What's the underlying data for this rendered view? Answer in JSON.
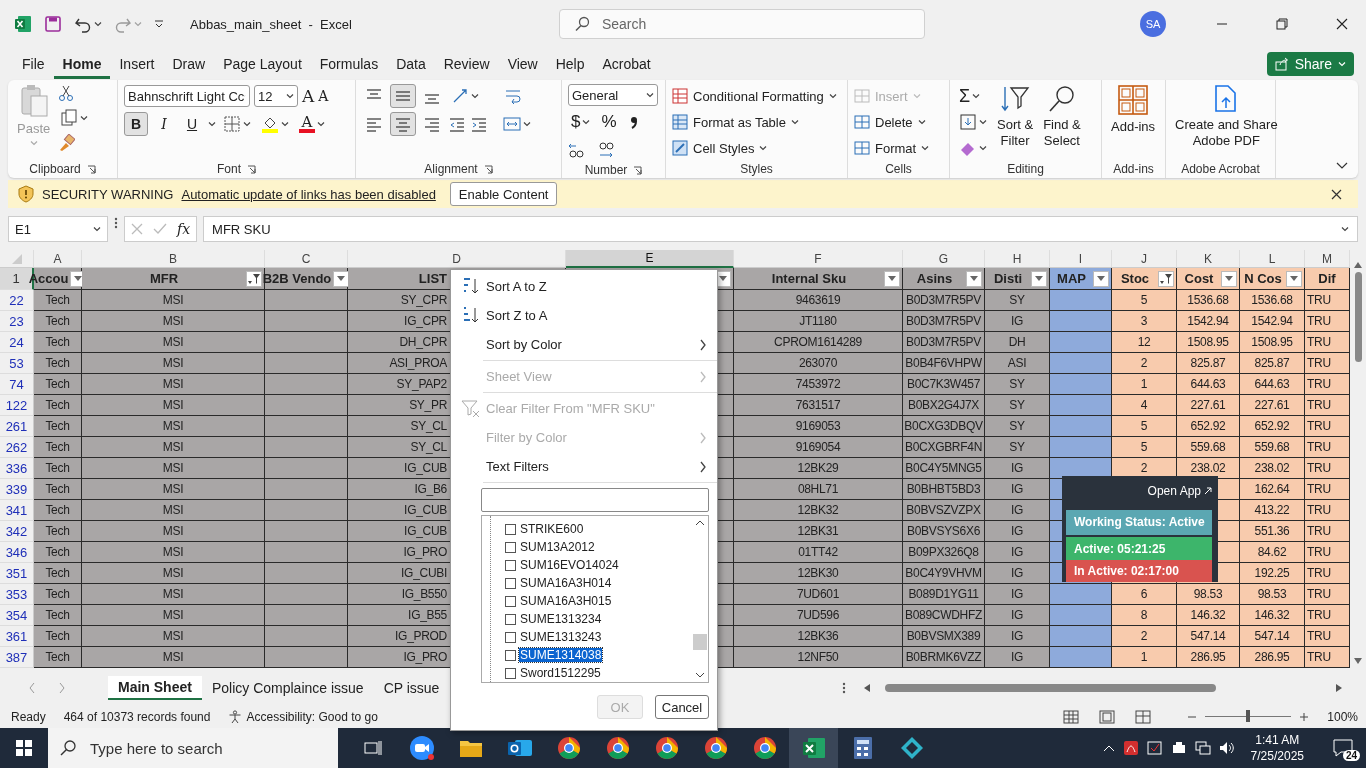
{
  "window": {
    "title": "Abbas_main_sheet  -  Excel",
    "search_placeholder": "Search",
    "avatar": "SA"
  },
  "menu_tabs": [
    {
      "label": "File",
      "selected": false
    },
    {
      "label": "Home",
      "selected": true
    },
    {
      "label": "Insert",
      "selected": false
    },
    {
      "label": "Draw",
      "selected": false
    },
    {
      "label": "Page Layout",
      "selected": false
    },
    {
      "label": "Formulas",
      "selected": false
    },
    {
      "label": "Data",
      "selected": false
    },
    {
      "label": "Review",
      "selected": false
    },
    {
      "label": "View",
      "selected": false
    },
    {
      "label": "Help",
      "selected": false
    },
    {
      "label": "Acrobat",
      "selected": false
    }
  ],
  "share": "Share",
  "ribbon": {
    "clipboard": {
      "paste": "Paste",
      "label": "Clipboard"
    },
    "font": {
      "name": "Bahnschrift Light Cc",
      "size": "12",
      "grow": "A",
      "shrink": "A",
      "color_letter": "A",
      "label": "Font",
      "styles": [
        {
          "label": "B",
          "selected": true
        },
        {
          "label": "I",
          "selected": false
        },
        {
          "label": "U",
          "selected": false
        }
      ]
    },
    "alignment": {
      "label": "Alignment",
      "vertical": [
        {
          "selected": false
        },
        {
          "selected": true
        },
        {
          "selected": false
        }
      ],
      "horizontal": [
        {
          "selected": false
        },
        {
          "selected": true
        },
        {
          "selected": false
        }
      ]
    },
    "number": {
      "format": "General",
      "currency": "$",
      "percent": "%",
      "label": "Number"
    },
    "styles": {
      "items": [
        "Conditional Formatting",
        "Format as Table",
        "Cell Styles"
      ],
      "label": "Styles"
    },
    "cells": {
      "items": [
        {
          "label": "Insert",
          "disabled": true
        },
        {
          "label": "Delete",
          "disabled": false
        },
        {
          "label": "Format",
          "disabled": false
        }
      ],
      "label": "Cells"
    },
    "editing": {
      "sum": "Σ",
      "sort": [
        "Sort &",
        "Filter"
      ],
      "find": [
        "Find &",
        "Select"
      ],
      "label": "Editing"
    },
    "addins": {
      "button": "Add-ins",
      "label": "Add-ins"
    },
    "acrobat": {
      "button": [
        "Create and Share",
        "Adobe PDF"
      ],
      "label": "Adobe Acrobat"
    }
  },
  "security_bar": {
    "title": "SECURITY WARNING",
    "message": "Automatic update of links has been disabled",
    "button": "Enable Content"
  },
  "formula_bar": {
    "name_box": "E1",
    "fx": "fx",
    "value": "MFR SKU"
  },
  "sheet": {
    "header_row": "1",
    "columns": [
      {
        "letter": "A",
        "header": "Accou",
        "filtered": false,
        "color": "#a9a6a6",
        "selected": false
      },
      {
        "letter": "B",
        "header": "MFR",
        "filtered": true,
        "color": "#a9a6a6",
        "selected": false
      },
      {
        "letter": "C",
        "header": "B2B Vendo",
        "filtered": false,
        "color": "#a9a6a6",
        "selected": false
      },
      {
        "letter": "D",
        "header": "LIST",
        "color": "#a9a6a6",
        "selected": false
      },
      {
        "letter": "E",
        "filtered": false,
        "color": "#a9a6a6",
        "selected": true
      },
      {
        "letter": "F",
        "header": "Internal Sku",
        "filtered": false,
        "color": "#a9a6a6",
        "selected": false
      },
      {
        "letter": "G",
        "header": "Asins",
        "filtered": false,
        "color": "#a9a6a6",
        "selected": false
      },
      {
        "letter": "H",
        "header": "Disti",
        "filtered": false,
        "color": "#a9a6a6",
        "selected": false
      },
      {
        "letter": "I",
        "header": "MAP",
        "filtered": false,
        "color": "#8eaadb",
        "selected": false
      },
      {
        "letter": "J",
        "header": "Stoc",
        "filtered": true,
        "color": "#f8cbad",
        "selected": false
      },
      {
        "letter": "K",
        "header": "Cost",
        "filtered": false,
        "color": "#f8cbad",
        "selected": false
      },
      {
        "letter": "L",
        "header": "N Cos",
        "filtered": false,
        "color": "#f8cbad",
        "selected": false
      },
      {
        "letter": "M",
        "header": "Dif",
        "color": "#f8cbad",
        "selected": false
      }
    ],
    "rows": [
      {
        "number": "22",
        "cells": [
          "Tech",
          "MSI",
          null,
          "SY_CPR",
          null,
          "9463619",
          "B0D3M7R5PV",
          "SY",
          null,
          "5",
          "1536.68",
          "1536.68",
          "TRU"
        ]
      },
      {
        "number": "23",
        "cells": [
          "Tech",
          "MSI",
          null,
          "IG_CPR",
          null,
          "JT1180",
          "B0D3M7R5PV",
          "IG",
          null,
          "3",
          "1542.94",
          "1542.94",
          "TRU"
        ]
      },
      {
        "number": "24",
        "cells": [
          "Tech",
          "MSI",
          null,
          "DH_CPR",
          null,
          "CPROM1614289",
          "B0D3M7R5PV",
          "DH",
          null,
          "12",
          "1508.95",
          "1508.95",
          "TRU"
        ]
      },
      {
        "number": "53",
        "cells": [
          "Tech",
          "MSI",
          null,
          "ASI_PROA",
          null,
          "263070",
          "B0B4F6VHPW",
          "ASI",
          null,
          "2",
          "825.87",
          "825.87",
          "TRU"
        ]
      },
      {
        "number": "74",
        "cells": [
          "Tech",
          "MSI",
          null,
          "SY_PAP2",
          null,
          "7453972",
          "B0C7K3W457",
          "SY",
          null,
          "1",
          "644.63",
          "644.63",
          "TRU"
        ]
      },
      {
        "number": "122",
        "cells": [
          "Tech",
          "MSI",
          null,
          "SY_PR",
          null,
          "7631517",
          "B0BX2G4J7X",
          "SY",
          null,
          "4",
          "227.61",
          "227.61",
          "TRU"
        ]
      },
      {
        "number": "261",
        "cells": [
          "Tech",
          "MSI",
          null,
          "SY_CL",
          null,
          "9169053",
          "B0CXG3DBQV",
          "SY",
          null,
          "5",
          "652.92",
          "652.92",
          "TRU"
        ]
      },
      {
        "number": "262",
        "cells": [
          "Tech",
          "MSI",
          null,
          "SY_CL",
          null,
          "9169054",
          "B0CXGBRF4N",
          "SY",
          null,
          "5",
          "559.68",
          "559.68",
          "TRU"
        ]
      },
      {
        "number": "336",
        "cells": [
          "Tech",
          "MSI",
          null,
          "IG_CUB",
          null,
          "12BK29",
          "B0C4Y5MNG5",
          "IG",
          null,
          "2",
          "238.02",
          "238.02",
          "TRU"
        ]
      },
      {
        "number": "339",
        "cells": [
          "Tech",
          "MSI",
          null,
          "IG_B6",
          null,
          "08HL71",
          "B0BHBT5BD3",
          "IG",
          null,
          null,
          null,
          "162.64",
          "TRU"
        ]
      },
      {
        "number": "341",
        "cells": [
          "Tech",
          "MSI",
          null,
          "IG_CUB",
          null,
          "12BK32",
          "B0BVSZVZPX",
          "IG",
          null,
          null,
          null,
          "413.22",
          "TRU"
        ]
      },
      {
        "number": "342",
        "cells": [
          "Tech",
          "MSI",
          null,
          "IG_CUB",
          null,
          "12BK31",
          "B0BVSYS6X6",
          "IG",
          null,
          null,
          null,
          "551.36",
          "TRU"
        ]
      },
      {
        "number": "346",
        "cells": [
          "Tech",
          "MSI",
          null,
          "IG_PRO",
          null,
          "01TT42",
          "B09PX326Q8",
          "IG",
          null,
          null,
          null,
          "84.62",
          "TRU"
        ]
      },
      {
        "number": "351",
        "cells": [
          "Tech",
          "MSI",
          null,
          "IG_CUBI",
          null,
          "12BK30",
          "B0C4Y9VHVM",
          "IG",
          null,
          null,
          null,
          "192.25",
          "TRU"
        ]
      },
      {
        "number": "353",
        "cells": [
          "Tech",
          "MSI",
          null,
          "IG_B550",
          null,
          "7UD601",
          "B089D1YG11",
          "IG",
          null,
          "6",
          "98.53",
          "98.53",
          "TRU"
        ]
      },
      {
        "number": "354",
        "cells": [
          "Tech",
          "MSI",
          null,
          "IG_B55",
          null,
          "7UD596",
          "B089CWDHFZ",
          "IG",
          null,
          "8",
          "146.32",
          "146.32",
          "TRU"
        ]
      },
      {
        "number": "361",
        "cells": [
          "Tech",
          "MSI",
          null,
          "IG_PROD",
          null,
          "12BK36",
          "B0BVSMX389",
          "IG",
          null,
          "2",
          "547.14",
          "547.14",
          "TRU"
        ]
      },
      {
        "number": "387",
        "cells": [
          "Tech",
          "MSI",
          null,
          "IG_PRO",
          null,
          "12NF50",
          "B0BRMK6VZZ",
          "IG",
          null,
          "1",
          "286.95",
          "286.95",
          "TRU"
        ]
      }
    ]
  },
  "filter_menu": {
    "items": [
      {
        "kind": "sort_asc",
        "label": "Sort A to Z",
        "disabled": false
      },
      {
        "kind": "sort_desc",
        "label": "Sort Z to A",
        "disabled": false
      },
      {
        "kind": "submenu",
        "label": "Sort by Color",
        "disabled": false
      },
      {
        "kind": "divider"
      },
      {
        "kind": "submenu",
        "label": "Sheet View",
        "disabled": true
      },
      {
        "kind": "divider"
      },
      {
        "kind": "clear",
        "label": "Clear Filter From \"MFR SKU\"",
        "disabled": true
      },
      {
        "kind": "submenu",
        "label": "Filter by Color",
        "disabled": true
      },
      {
        "kind": "submenu",
        "label": "Text Filters",
        "disabled": false
      },
      {
        "kind": "divider"
      }
    ],
    "values": [
      {
        "label": "STRIKE600",
        "checked": false,
        "selected": false
      },
      {
        "label": "SUM13A2012",
        "checked": false,
        "selected": false
      },
      {
        "label": "SUM16EVO14024",
        "checked": false,
        "selected": false
      },
      {
        "label": "SUMA16A3H014",
        "checked": false,
        "selected": false
      },
      {
        "label": "SUMA16A3H015",
        "checked": false,
        "selected": false
      },
      {
        "label": "SUME1313234",
        "checked": false,
        "selected": false
      },
      {
        "label": "SUME1313243",
        "checked": false,
        "selected": false
      },
      {
        "label": "SUME1314038",
        "checked": false,
        "selected": true
      },
      {
        "label": "Sword1512295",
        "checked": false,
        "selected": false
      }
    ],
    "buttons": [
      {
        "label": "OK",
        "disabled": true
      },
      {
        "label": "Cancel",
        "disabled": false
      }
    ]
  },
  "status_widget": {
    "open_app": "Open App",
    "status": "Working Status: Active",
    "active": "Active: 05:21:25",
    "inactive": "In Active: 02:17:00"
  },
  "sheet_tabs": [
    {
      "label": "Main Sheet",
      "selected": true
    },
    {
      "label": "Policy Complaince issue",
      "selected": false
    },
    {
      "label": "CP issue",
      "selected": false
    }
  ],
  "status_bar": {
    "ready": "Ready",
    "records": "464 of 10373 records found",
    "accessibility": "Accessibility: Good to go",
    "zoom": "100%",
    "level": 0.5
  },
  "taskbar": {
    "search_placeholder": "Type here to search",
    "time": "1:41 AM",
    "date": "7/25/2025",
    "notifications": "24"
  }
}
